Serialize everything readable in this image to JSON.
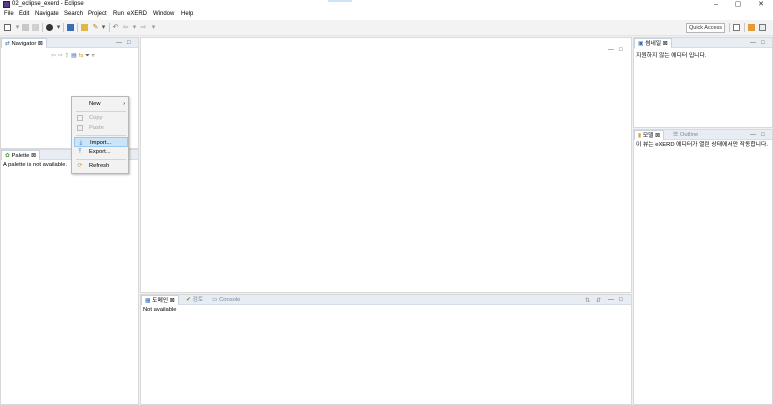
{
  "window": {
    "title": "02_eclipse_exerd - Eclipse",
    "controls": {
      "minimize": "–",
      "maximize": "▢",
      "close": "✕"
    }
  },
  "menu": [
    "File",
    "Edit",
    "Navigate",
    "Search",
    "Project",
    "Run",
    "eXERD",
    "Window",
    "Help"
  ],
  "toolbar": {
    "quick_access": "Quick Access"
  },
  "navigator": {
    "tab": "Navigator",
    "close_glyph": "⊠"
  },
  "palette": {
    "tab": "Palette",
    "close_glyph": "⊠",
    "message": "A palette is not available."
  },
  "context_menu": {
    "items": [
      {
        "label": "New",
        "has_submenu": true,
        "enabled": true
      },
      {
        "label": "Copy",
        "enabled": false
      },
      {
        "label": "Paste",
        "enabled": false
      },
      {
        "label": "Import...",
        "enabled": true,
        "highlighted": true
      },
      {
        "label": "Export...",
        "enabled": true
      },
      {
        "label": "Refresh",
        "enabled": true
      }
    ],
    "submenu_arrow": "›"
  },
  "detail_view": {
    "tab": "썸네일",
    "close_glyph": "⊠",
    "message": "지원하지 않는 에디터 입니다."
  },
  "model_view": {
    "tab_model": "모델",
    "tab_outline": "Outline",
    "close_glyph": "⊠",
    "message": "이 뷰는 eXERD 에디터가 열린 상태에서만 작동합니다."
  },
  "bottom_view": {
    "tab_domain": "도메인",
    "tab_review": "검토",
    "tab_console": "Console",
    "close_glyph": "⊠",
    "message": "Not available"
  },
  "colors": {
    "tab_bar": "#e8edf3",
    "highlight": "#cce4f7",
    "panel_bg": "#ffffff",
    "window_bg": "#f0f0f0"
  }
}
